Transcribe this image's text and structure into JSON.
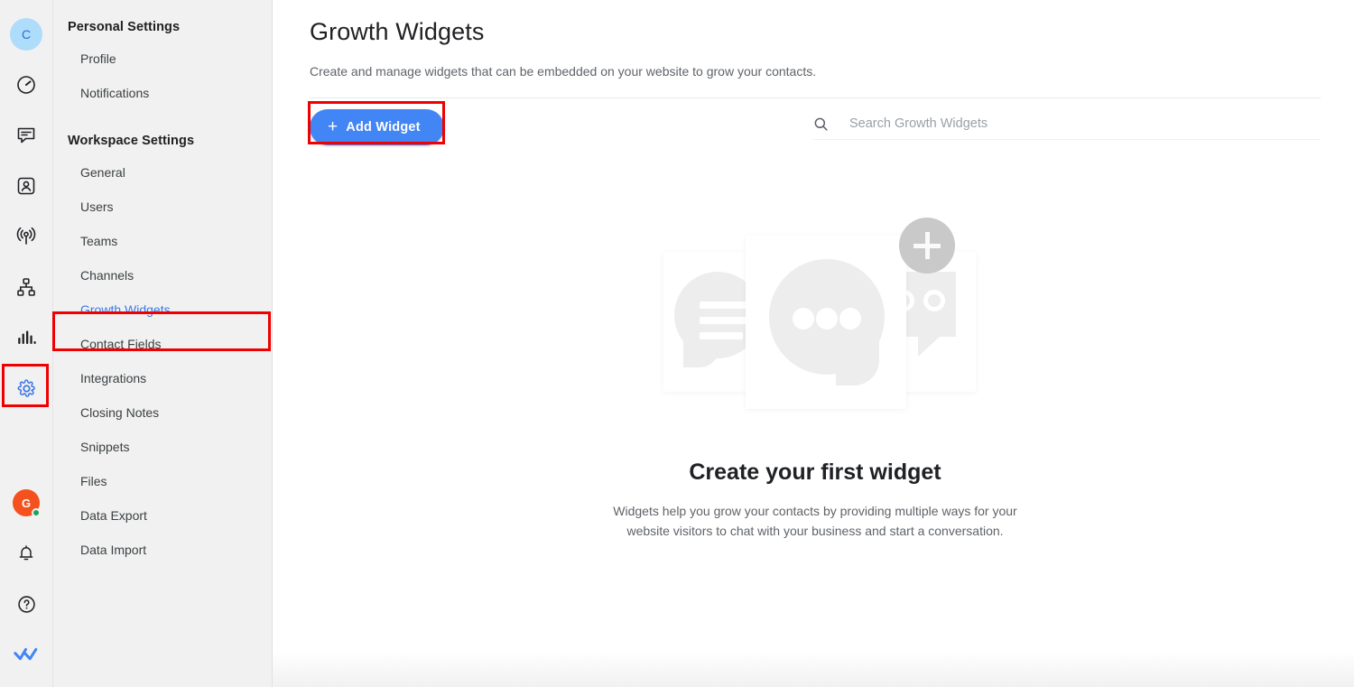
{
  "rail": {
    "top_items": [
      {
        "name": "workspace-avatar",
        "icon": "avatar-letter",
        "label": "C"
      },
      {
        "name": "dashboard",
        "icon": "speedometer-icon",
        "label": "Dashboard"
      },
      {
        "name": "conversations",
        "icon": "chat-icon",
        "label": "Conversations"
      },
      {
        "name": "contacts",
        "icon": "contact-card-icon",
        "label": "Contacts"
      },
      {
        "name": "broadcast",
        "icon": "broadcast-icon",
        "label": "Broadcast"
      },
      {
        "name": "workflows",
        "icon": "sitemap-icon",
        "label": "Workflows"
      },
      {
        "name": "reports",
        "icon": "bar-chart-icon",
        "label": "Reports"
      },
      {
        "name": "settings",
        "icon": "gear-icon",
        "label": "Settings"
      }
    ],
    "bottom_items": [
      {
        "name": "user-avatar",
        "icon": "avatar-letter",
        "label": "G",
        "presence": "online"
      },
      {
        "name": "notifications",
        "icon": "bell-icon",
        "label": "Notifications"
      },
      {
        "name": "help",
        "icon": "help-circle-icon",
        "label": "Help"
      },
      {
        "name": "app-logo",
        "icon": "double-check-icon",
        "label": "App"
      }
    ]
  },
  "settings_nav": {
    "personal_title": "Personal Settings",
    "personal_items": [
      {
        "label": "Profile"
      },
      {
        "label": "Notifications"
      }
    ],
    "workspace_title": "Workspace Settings",
    "workspace_items": [
      {
        "label": "General"
      },
      {
        "label": "Users"
      },
      {
        "label": "Teams"
      },
      {
        "label": "Channels"
      },
      {
        "label": "Growth Widgets"
      },
      {
        "label": "Contact Fields"
      },
      {
        "label": "Integrations"
      },
      {
        "label": "Closing Notes"
      },
      {
        "label": "Snippets"
      },
      {
        "label": "Files"
      },
      {
        "label": "Data Export"
      },
      {
        "label": "Data Import"
      }
    ],
    "active_label": "Growth Widgets"
  },
  "main": {
    "title": "Growth Widgets",
    "subtitle": "Create and manage widgets that can be embedded on your website to grow your contacts.",
    "add_button_label": "Add Widget",
    "add_button_plus": "+",
    "search_placeholder": "Search Growth Widgets",
    "search_value": "",
    "empty_state": {
      "title": "Create your first widget",
      "description": "Widgets help you grow your contacts by providing multiple ways for your website visitors to chat with your business and start a conversation."
    }
  },
  "colors": {
    "accent_blue": "#4285f4",
    "active_link_blue": "#3b78e7",
    "annotation_red": "#f00000",
    "avatar_blue_bg": "#aedcfb",
    "avatar_orange_bg": "#f4511e",
    "presence_green": "#18a558",
    "rail_bg": "#f1f1f1",
    "illustration_gray": "#ededed"
  }
}
